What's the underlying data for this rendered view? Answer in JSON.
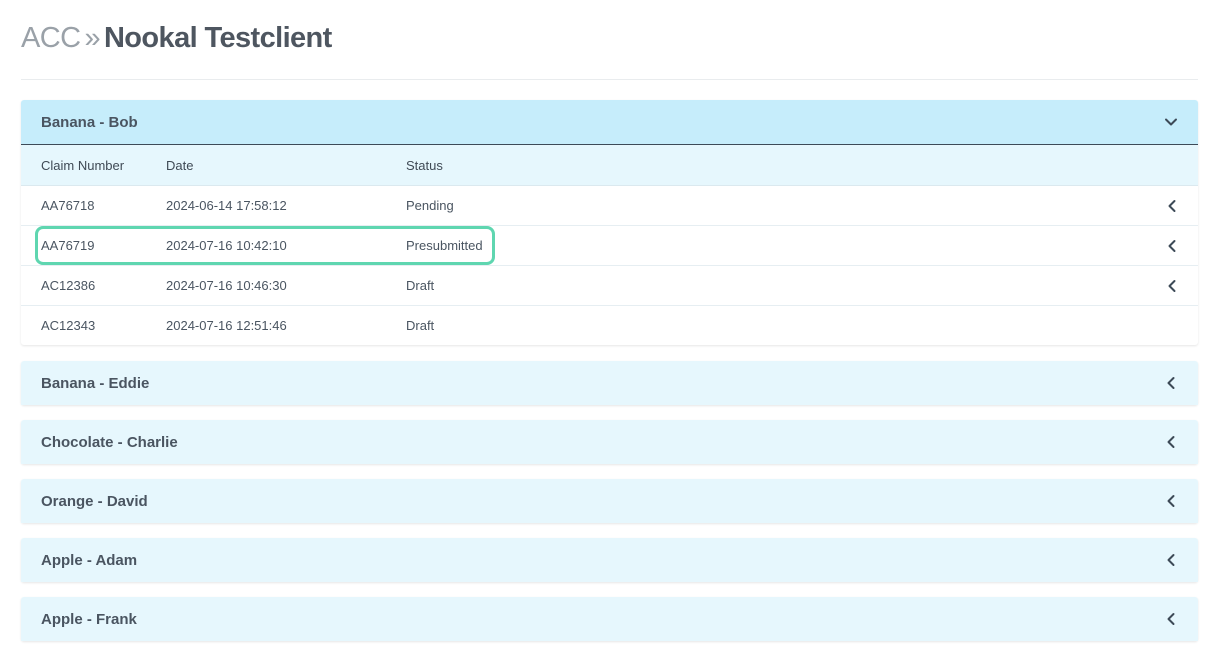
{
  "header": {
    "breadcrumb": "ACC",
    "separator": "»",
    "title": "Nookal Testclient"
  },
  "panels": [
    {
      "title": "Banana - Bob",
      "expanded": true,
      "columns": [
        "Claim Number",
        "Date",
        "Status"
      ],
      "rows": [
        {
          "claim_number": "AA76718",
          "date": "2024-06-14 17:58:12",
          "status": "Pending",
          "has_arrow": true
        },
        {
          "claim_number": "AA76719",
          "date": "2024-07-16 10:42:10",
          "status": "Presubmitted",
          "has_arrow": true,
          "highlighted": true
        },
        {
          "claim_number": "AC12386",
          "date": "2024-07-16 10:46:30",
          "status": "Draft",
          "has_arrow": true
        },
        {
          "claim_number": "AC12343",
          "date": "2024-07-16 12:51:46",
          "status": "Draft",
          "has_arrow": false
        }
      ]
    },
    {
      "title": "Banana - Eddie",
      "expanded": false
    },
    {
      "title": "Chocolate - Charlie",
      "expanded": false
    },
    {
      "title": "Orange - David",
      "expanded": false
    },
    {
      "title": "Apple - Adam",
      "expanded": false
    },
    {
      "title": "Apple - Frank",
      "expanded": false
    }
  ],
  "icons": {
    "expanded": "chevron-down-icon",
    "collapsed": "chevron-left-icon",
    "row": "chevron-left-icon"
  },
  "colors": {
    "panel_header": "#e6f7fd",
    "panel_header_open": "#c6edfb",
    "highlight": "#5fd6b0"
  }
}
